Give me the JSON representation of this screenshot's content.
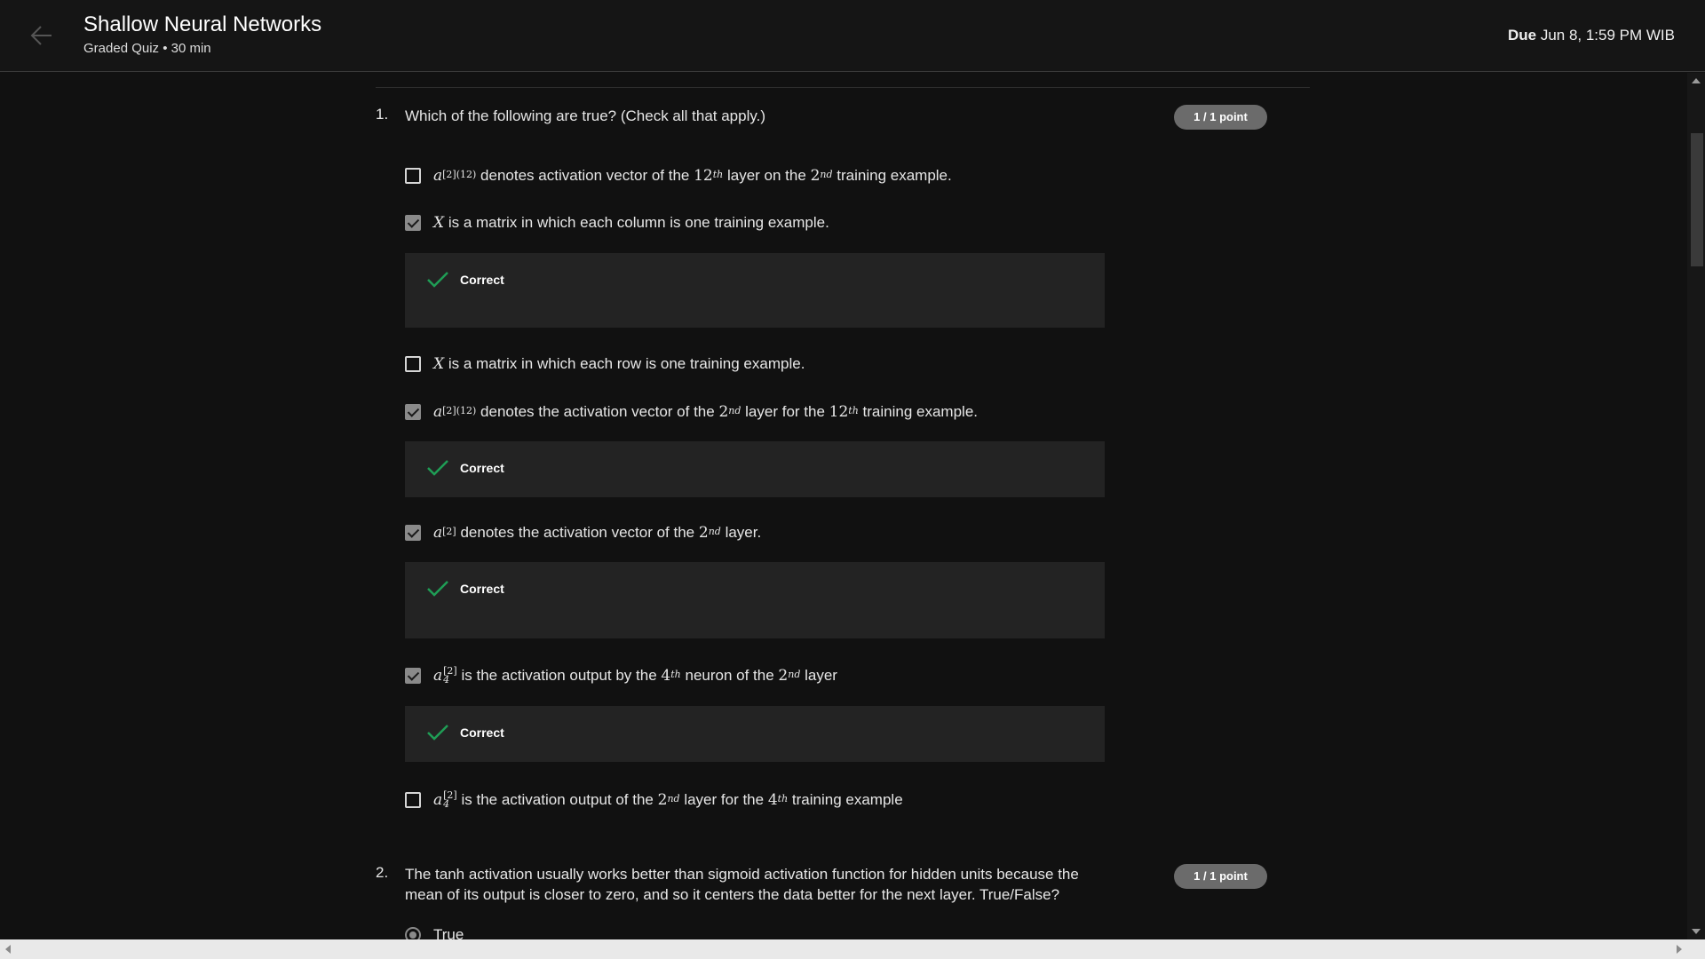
{
  "header": {
    "title": "Shallow Neural Networks",
    "subtitle": "Graded Quiz • 30 min",
    "due_label": "Due",
    "due_value": "Jun 8, 1:59 PM WIB"
  },
  "colors": {
    "accent_check": "#1f9d55",
    "points_badge": "#6b6b6b",
    "background": "#111111"
  },
  "questions": [
    {
      "number": "1.",
      "text": "Which of the following are true? (Check all that apply.)",
      "points": "1 / 1 point",
      "options": [
        {
          "checked": false,
          "text": "denotes activation vector of the 12th layer on the 2nd training example.",
          "feedback": null
        },
        {
          "checked": true,
          "text": "is a matrix in which each column is one training example.",
          "feedback": "Correct"
        },
        {
          "checked": false,
          "text": "is a matrix in which each row is one training example.",
          "feedback": null
        },
        {
          "checked": true,
          "text": "denotes the activation vector of the 2nd layer for the 12th training example.",
          "feedback": "Correct"
        },
        {
          "checked": true,
          "text": "denotes the activation vector of the 2nd layer.",
          "feedback": "Correct"
        },
        {
          "checked": true,
          "text": "is the activation output by the 4th neuron of the 2nd layer",
          "feedback": "Correct"
        },
        {
          "checked": false,
          "text": "is the activation output of the 2nd layer for the 4th training example",
          "feedback": null
        }
      ]
    },
    {
      "number": "2.",
      "text": "The tanh activation usually works better than sigmoid activation function for hidden units because the mean of its output is closer to zero, and so it centers the data better for the next layer. True/False?",
      "points": "1 / 1 point",
      "options": [
        {
          "selected": true,
          "text": "True"
        }
      ]
    }
  ],
  "math": {
    "a": "a",
    "X": "X",
    "sup_2_12": "[2](12)",
    "sup_2": "[2]",
    "sub_4": "4",
    "n12": "12",
    "th": "th",
    "n2": "2",
    "nd": "nd",
    "n4": "4"
  },
  "text_fragments": {
    "o1_a": "denotes activation vector of the",
    "o1_b": "layer on the",
    "o1_c": "training example.",
    "o2": "is a matrix in which each column is one training example.",
    "o3": "is a matrix in which each row is one training example.",
    "o4_a": "denotes the activation vector of the",
    "o4_b": "layer for the",
    "o4_c": "training example.",
    "o5_a": "denotes the activation vector of the",
    "o5_b": "layer.",
    "o6_a": "is the activation output by the",
    "o6_b": "neuron of the",
    "o6_c": "layer",
    "o7_a": "is the activation output of the",
    "o7_b": "layer for the",
    "o7_c": "training example"
  }
}
